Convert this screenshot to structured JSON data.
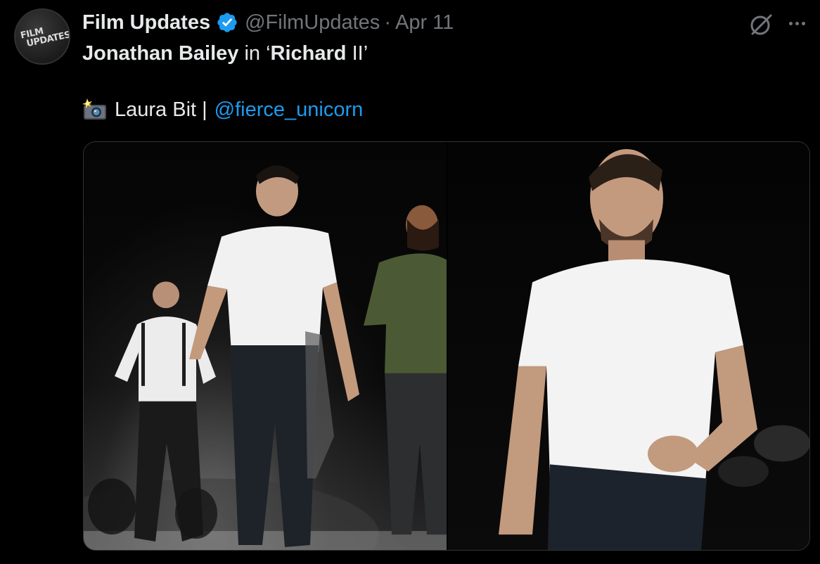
{
  "author": {
    "display_name": "Film Updates",
    "handle": "@FilmUpdates",
    "separator": "·",
    "date": "Apr 11",
    "avatar_text_line1": "FILM",
    "avatar_text_line2": "UPDATES",
    "verified_color": "#1d9bf0"
  },
  "tweet": {
    "line1_bold_1": "Jonathan Bailey",
    "line1_plain": " in ‘",
    "line1_bold_2": "Richard",
    "line1_end": " II’",
    "credit_icon": "camera-flash-icon",
    "credit_name": "Laura Bit |",
    "credit_mention": "@fierce_unicorn"
  },
  "media": {
    "photos": [
      {
        "name": "stage-curtain-call-group"
      },
      {
        "name": "stage-curtain-call-closeup"
      }
    ]
  },
  "icons": {
    "grok": "grok-icon",
    "more": "more-icon"
  },
  "colors": {
    "background": "#000000",
    "text": "#e7e9ea",
    "muted": "#71767b",
    "link": "#1d9bf0",
    "border": "#2f3336"
  }
}
